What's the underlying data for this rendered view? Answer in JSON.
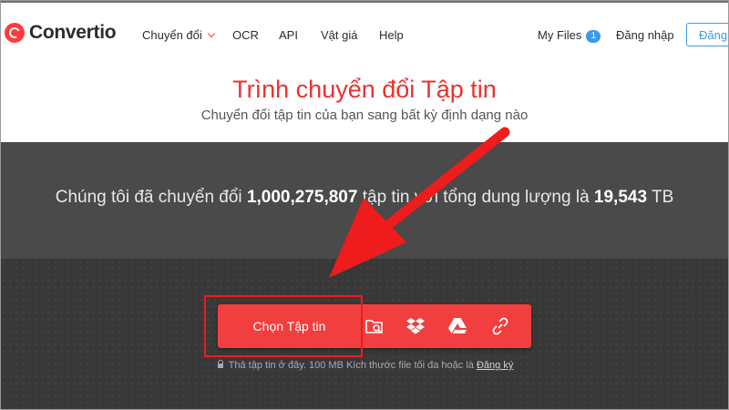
{
  "header": {
    "logo_text": "Convertio",
    "nav": [
      {
        "label": "Chuyển đổi"
      },
      {
        "label": "OCR"
      },
      {
        "label": "API"
      },
      {
        "label": "Vật giá"
      },
      {
        "label": "Help"
      }
    ],
    "my_files": "My Files",
    "my_files_count": "1",
    "login": "Đăng nhập",
    "signup": "Đăng ký"
  },
  "hero": {
    "title": "Trình chuyển đổi Tập tin",
    "subtitle": "Chuyển đổi tập tin của bạn sang bất kỳ định dạng nào"
  },
  "stats": {
    "prefix": "Chúng tôi đã chuyển đổi",
    "files_count": "1,000,275,807",
    "middle": "tập tin với tổng dung lượng là",
    "total_size": "19,543",
    "unit": "TB"
  },
  "upload": {
    "choose_label": "Chọn Tập tin",
    "sources": [
      {
        "icon": "folder-search-icon"
      },
      {
        "icon": "dropbox-icon"
      },
      {
        "icon": "google-drive-icon"
      },
      {
        "icon": "link-icon"
      }
    ],
    "hint_text": "Thả tập tin ở đây. 100 MB Kích thước file tối đa hoặc là",
    "hint_link": "Đăng ký"
  },
  "colors": {
    "accent": "#f13e3e",
    "brand_blue": "#3a9ce8",
    "annotation": "#ee1c1c"
  }
}
